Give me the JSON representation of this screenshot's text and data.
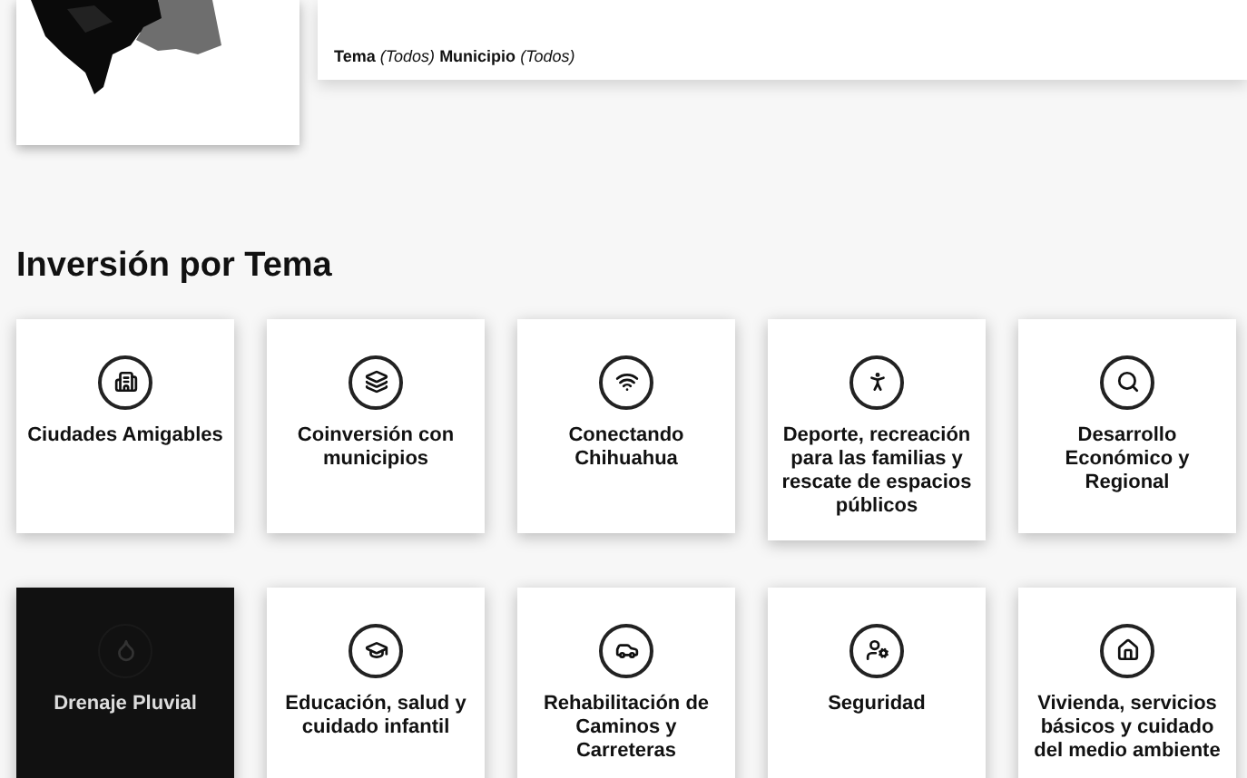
{
  "filters": {
    "text": "**Tema** *(Todos)* **Municipio** *(Todos)*"
  },
  "section": {
    "title": "Inversión por Tema"
  },
  "topics": [
    {
      "label": "Ciudades Amigables",
      "kind": "buildings",
      "selected": false
    },
    {
      "label": "Coinversión con municipios",
      "kind": "stack",
      "selected": false
    },
    {
      "label": "Conectando Chihuahua",
      "kind": "wifi",
      "selected": false
    },
    {
      "label": "Deporte, recreación para las familias y rescate de espacios públicos",
      "kind": "running",
      "selected": false
    },
    {
      "label": "Desarrollo Económico y Regional",
      "kind": "search",
      "selected": false
    },
    {
      "label": "Drenaje Pluvial",
      "kind": "drop",
      "selected": true
    },
    {
      "label": "Educación, salud y cuidado infantil",
      "kind": "graduation",
      "selected": false
    },
    {
      "label": "Rehabilitación de Caminos y Carreteras",
      "kind": "car",
      "selected": false
    },
    {
      "label": "Seguridad",
      "kind": "user",
      "selected": false
    },
    {
      "label": "Vivienda, servicios básicos y cuidado del medio ambiente",
      "kind": "home",
      "selected": false
    }
  ]
}
